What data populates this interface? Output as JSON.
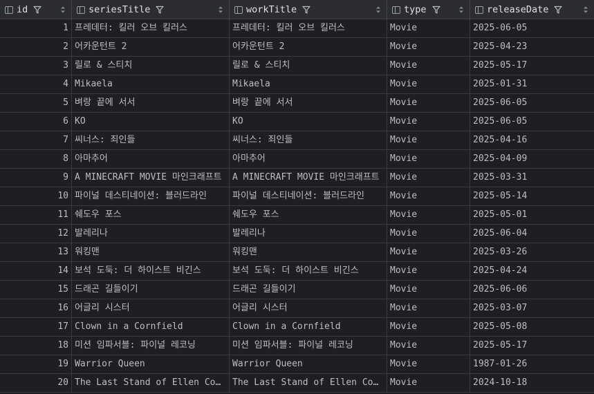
{
  "columns": [
    {
      "name": "id"
    },
    {
      "name": "seriesTitle"
    },
    {
      "name": "workTitle"
    },
    {
      "name": "type"
    },
    {
      "name": "releaseDate"
    }
  ],
  "rows": [
    {
      "id": "1",
      "seriesTitle": "프레데터: 킬러 오브 킬러스",
      "workTitle": "프레데터: 킬러 오브 킬러스",
      "type": "Movie",
      "releaseDate": "2025-06-05"
    },
    {
      "id": "2",
      "seriesTitle": "어카운턴트 2",
      "workTitle": "어카운턴트 2",
      "type": "Movie",
      "releaseDate": "2025-04-23"
    },
    {
      "id": "3",
      "seriesTitle": "릴로 & 스티치",
      "workTitle": "릴로 & 스티치",
      "type": "Movie",
      "releaseDate": "2025-05-17"
    },
    {
      "id": "4",
      "seriesTitle": "Mikaela",
      "workTitle": "Mikaela",
      "type": "Movie",
      "releaseDate": "2025-01-31"
    },
    {
      "id": "5",
      "seriesTitle": "벼랑 끝에 서서",
      "workTitle": "벼랑 끝에 서서",
      "type": "Movie",
      "releaseDate": "2025-06-05"
    },
    {
      "id": "6",
      "seriesTitle": "KO",
      "workTitle": "KO",
      "type": "Movie",
      "releaseDate": "2025-06-05"
    },
    {
      "id": "7",
      "seriesTitle": "씨너스: 죄인들",
      "workTitle": "씨너스: 죄인들",
      "type": "Movie",
      "releaseDate": "2025-04-16"
    },
    {
      "id": "8",
      "seriesTitle": "아마추어",
      "workTitle": "아마추어",
      "type": "Movie",
      "releaseDate": "2025-04-09"
    },
    {
      "id": "9",
      "seriesTitle": "A MINECRAFT MOVIE 마인크래프트",
      "workTitle": "A MINECRAFT MOVIE 마인크래프트",
      "type": "Movie",
      "releaseDate": "2025-03-31"
    },
    {
      "id": "10",
      "seriesTitle": "파이널 데스티네이션: 블러드라인",
      "workTitle": "파이널 데스티네이션: 블러드라인",
      "type": "Movie",
      "releaseDate": "2025-05-14"
    },
    {
      "id": "11",
      "seriesTitle": "쉐도우 포스",
      "workTitle": "쉐도우 포스",
      "type": "Movie",
      "releaseDate": "2025-05-01"
    },
    {
      "id": "12",
      "seriesTitle": "발레리나",
      "workTitle": "발레리나",
      "type": "Movie",
      "releaseDate": "2025-06-04"
    },
    {
      "id": "13",
      "seriesTitle": "워킹맨",
      "workTitle": "워킹맨",
      "type": "Movie",
      "releaseDate": "2025-03-26"
    },
    {
      "id": "14",
      "seriesTitle": "보석 도둑: 더 하이스트 비긴스",
      "workTitle": "보석 도둑: 더 하이스트 비긴스",
      "type": "Movie",
      "releaseDate": "2025-04-24"
    },
    {
      "id": "15",
      "seriesTitle": "드래곤 길들이기",
      "workTitle": "드래곤 길들이기",
      "type": "Movie",
      "releaseDate": "2025-06-06"
    },
    {
      "id": "16",
      "seriesTitle": "어글리 시스터",
      "workTitle": "어글리 시스터",
      "type": "Movie",
      "releaseDate": "2025-03-07"
    },
    {
      "id": "17",
      "seriesTitle": "Clown in a Cornfield",
      "workTitle": "Clown in a Cornfield",
      "type": "Movie",
      "releaseDate": "2025-05-08"
    },
    {
      "id": "18",
      "seriesTitle": "미션 임파서블: 파이널 레코닝",
      "workTitle": "미션 임파서블: 파이널 레코닝",
      "type": "Movie",
      "releaseDate": "2025-05-17"
    },
    {
      "id": "19",
      "seriesTitle": "Warrior Queen",
      "workTitle": "Warrior Queen",
      "type": "Movie",
      "releaseDate": "1987-01-26"
    },
    {
      "id": "20",
      "seriesTitle": "The Last Stand of Ellen Co…",
      "workTitle": "The Last Stand of Ellen Co…",
      "type": "Movie",
      "releaseDate": "2024-10-18"
    }
  ],
  "icons": {
    "column": "column-icon",
    "filter": "filter-icon",
    "sort": "sort-icon"
  },
  "colors": {
    "background": "#1e1f22",
    "header": "#2b2d30",
    "text": "#bcbec4"
  }
}
